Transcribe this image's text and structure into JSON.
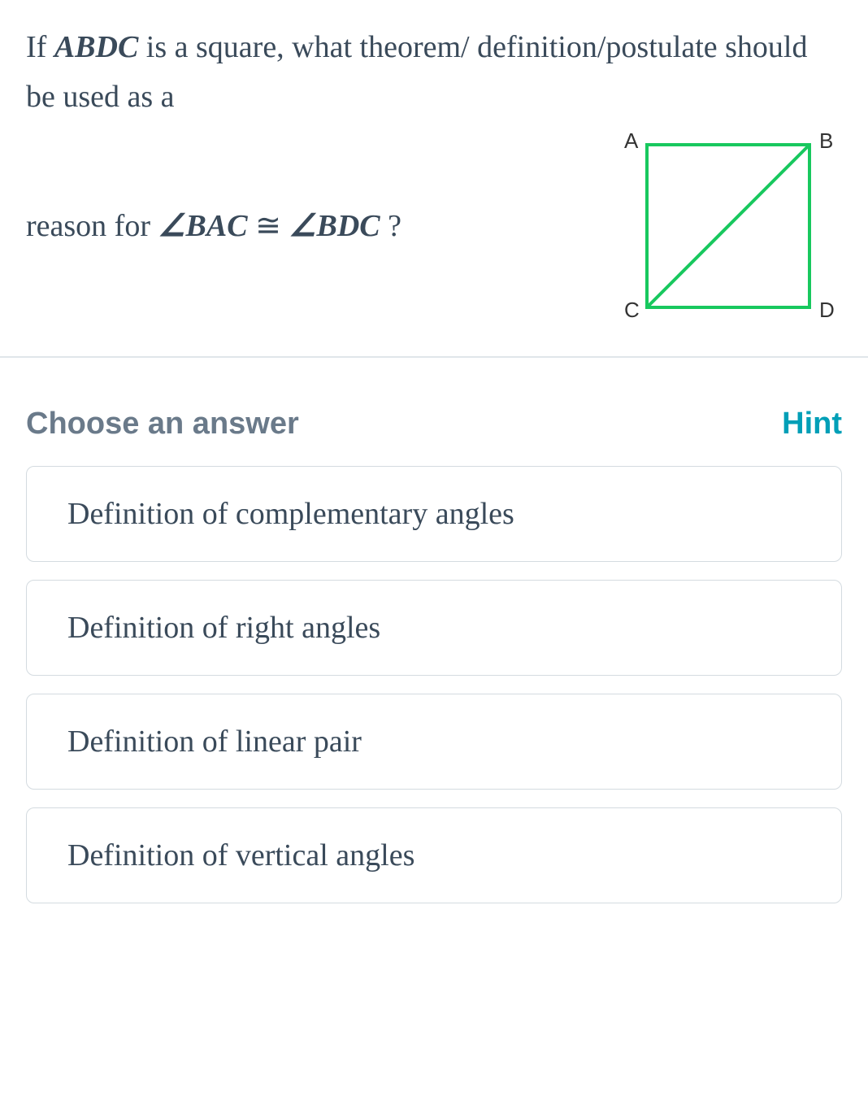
{
  "question": {
    "intro_prefix": "If ",
    "square_name": "ABDC",
    "intro_suffix": " is a square, what theorem/ definition/postulate should be used as a",
    "reason_prefix": "reason for ",
    "angle1": "∠BAC",
    "congruent": "≅",
    "angle2": "∠BDC",
    "reason_suffix": " ?"
  },
  "diagram": {
    "labels": {
      "tl": "A",
      "tr": "B",
      "bl": "C",
      "br": "D"
    }
  },
  "choose_label": "Choose an answer",
  "hint_label": "Hint",
  "options": [
    "Definition of complementary angles",
    "Definition of right angles",
    "Definition of linear pair",
    "Definition of vertical angles"
  ]
}
